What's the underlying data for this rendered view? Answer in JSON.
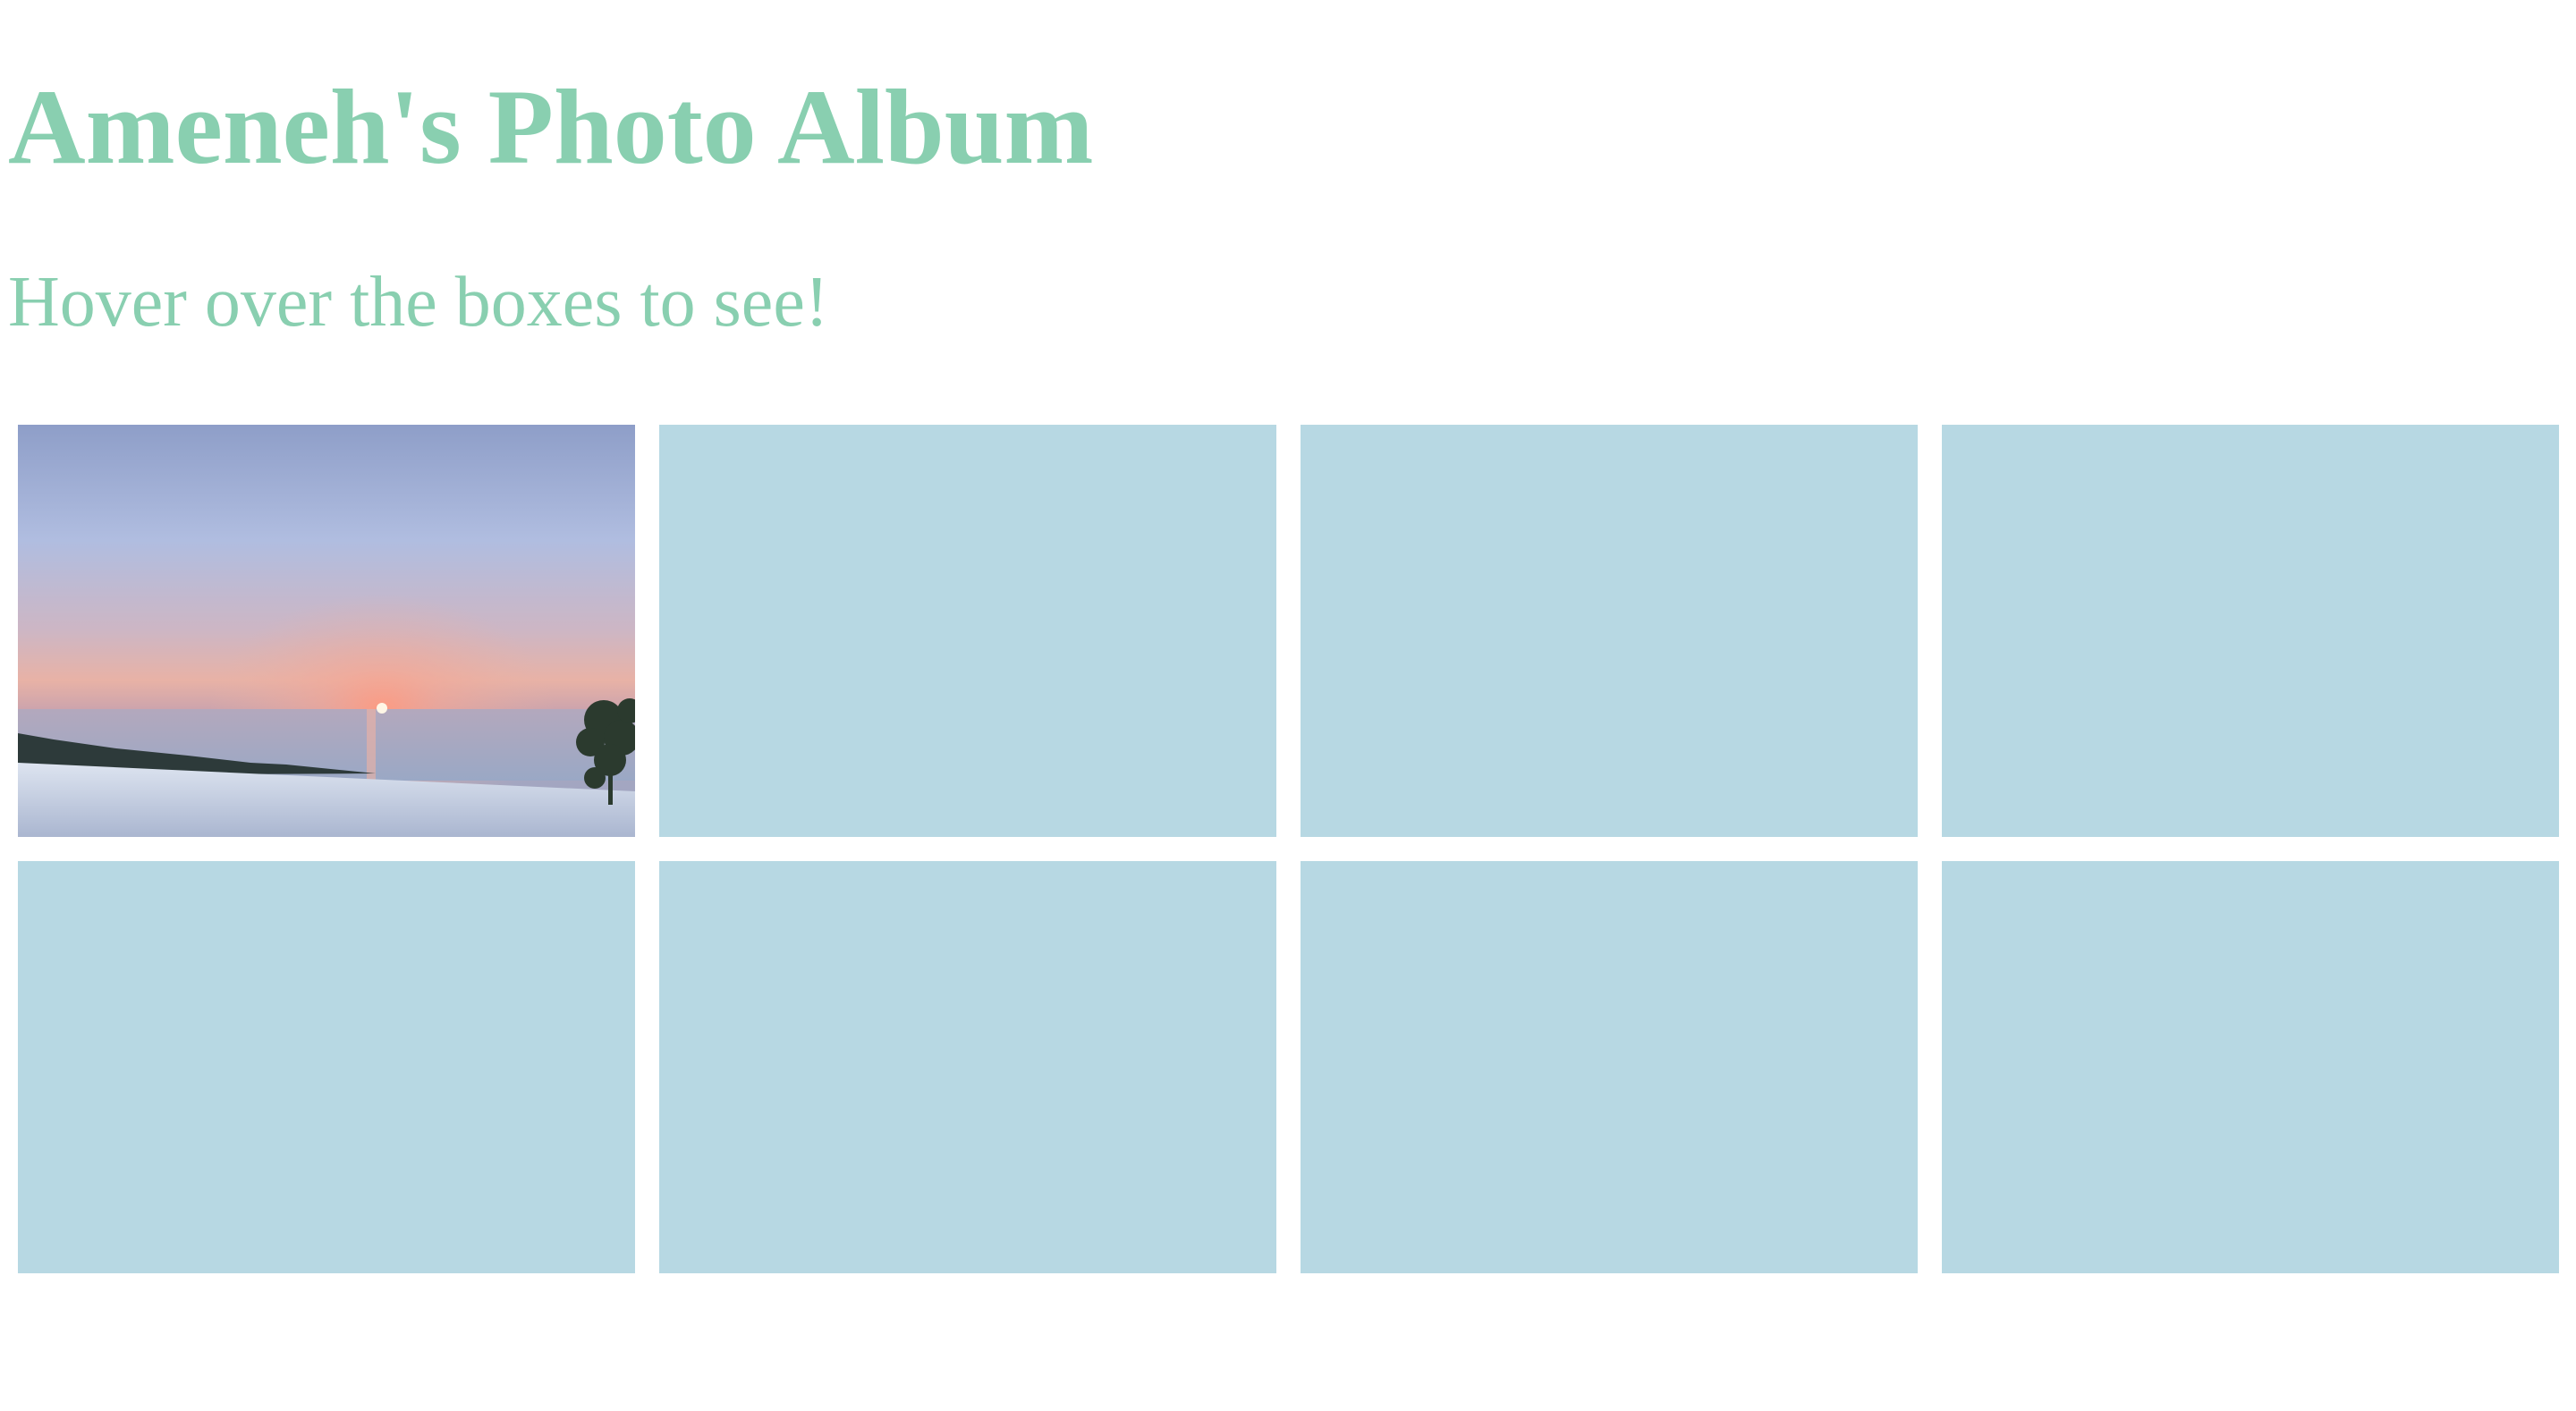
{
  "page": {
    "title": "Ameneh's Photo Album",
    "subtitle": "Hover over the boxes to see!"
  },
  "colors": {
    "heading": "#89cfb0",
    "box": "#b7d8e3",
    "background": "#ffffff"
  },
  "gallery": {
    "boxes": [
      {
        "state": "revealed",
        "content": "sunset-over-sea-photo"
      },
      {
        "state": "hidden"
      },
      {
        "state": "hidden"
      },
      {
        "state": "hidden"
      },
      {
        "state": "hidden"
      },
      {
        "state": "hidden"
      },
      {
        "state": "hidden"
      },
      {
        "state": "hidden"
      }
    ]
  }
}
